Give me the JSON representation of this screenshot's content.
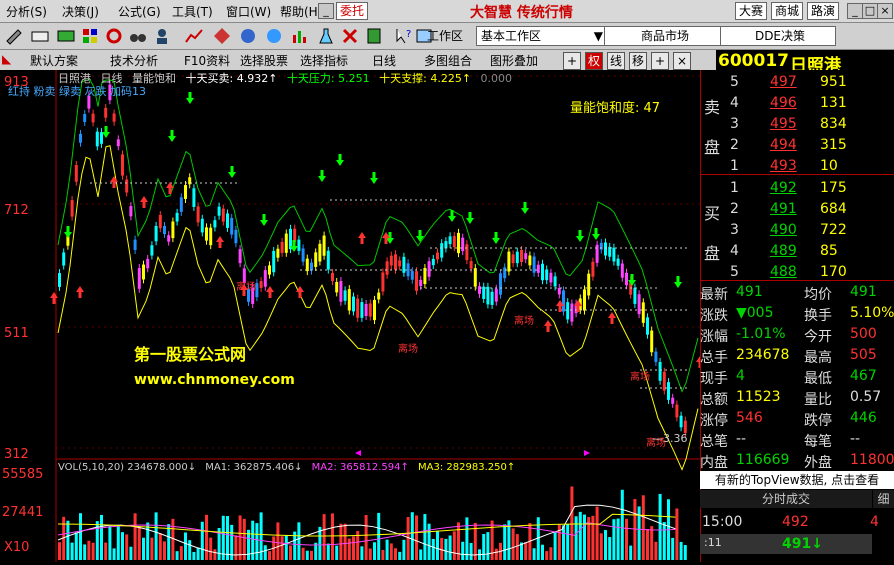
{
  "menu": {
    "items": [
      "分析(S)",
      "决策(J)",
      "公式(G)",
      "工具(T)",
      "窗口(W)",
      "帮助(H)"
    ],
    "trade": "委托",
    "brand": "大智慧 传统行情",
    "right_buttons": [
      "大赛",
      "商城",
      "路演"
    ]
  },
  "toolbar": {
    "workspace_label": "工作区",
    "workspace_value": "基本工作区",
    "market": "商品市场",
    "dde": "DDE决策"
  },
  "funcbar": {
    "items": [
      "默认方案",
      "技术分析",
      "F10资料",
      "选择股票",
      "选择指标",
      "日线",
      "多图组合",
      "图形叠加"
    ],
    "squares": [
      "权",
      "线",
      "移",
      "+",
      "×"
    ]
  },
  "stock": {
    "code": "600017",
    "name": "日照港"
  },
  "chart": {
    "top_line": {
      "name": "日照港",
      "period": "日线",
      "indicator": "量能饱和",
      "items": [
        {
          "label": "十天买卖: 4.932↑",
          "value": "4.932↑",
          "color": "#ffffff"
        },
        {
          "label": "十天压力: 5.251",
          "value": "5.251",
          "color": "#00ff00"
        },
        {
          "label": "十天支撑: 4.225↑",
          "value": "4.225↑",
          "color": "#ffff00"
        },
        {
          "label": "0.000",
          "value": "0.000",
          "color": "#888888"
        }
      ]
    },
    "legend2": "红持 粉卖 绿卖 灰跌 加码13",
    "saturation": "量能饱和度: 47",
    "watermark_title": "第一股票公式网",
    "watermark_url": "www.chnmoney.com",
    "low_label": "3.36",
    "signal_text": "离场",
    "y_labels": [
      "913",
      "712",
      "511",
      "312"
    ],
    "vol_title": "VOL(5,10,20) 234678.000↓",
    "ma1": "MA1: 362875.406↓",
    "ma2": "MA2: 365812.594↑",
    "ma3": "MA3: 282983.250↑",
    "vol_labels": [
      "55585",
      "27441"
    ],
    "vol_unit": "X10"
  },
  "quote": {
    "sell_label": [
      "卖",
      "盘"
    ],
    "buy_label": [
      "买",
      "盘"
    ],
    "asks": [
      {
        "lvl": "5",
        "price": "497",
        "vol": "951"
      },
      {
        "lvl": "4",
        "price": "496",
        "vol": "131"
      },
      {
        "lvl": "3",
        "price": "495",
        "vol": "834"
      },
      {
        "lvl": "2",
        "price": "494",
        "vol": "315"
      },
      {
        "lvl": "1",
        "price": "493",
        "vol": "10"
      }
    ],
    "bids": [
      {
        "lvl": "1",
        "price": "492",
        "vol": "175"
      },
      {
        "lvl": "2",
        "price": "491",
        "vol": "684"
      },
      {
        "lvl": "3",
        "price": "490",
        "vol": "722"
      },
      {
        "lvl": "4",
        "price": "489",
        "vol": "85"
      },
      {
        "lvl": "5",
        "price": "488",
        "vol": "170"
      }
    ],
    "stats": [
      {
        "k1": "最新",
        "v1": "491",
        "c1": "g",
        "k2": "均价",
        "v2": "491",
        "c2": "g"
      },
      {
        "k1": "涨跌",
        "v1": "▼005",
        "c1": "g",
        "k2": "换手",
        "v2": "5.10%",
        "c2": "y"
      },
      {
        "k1": "涨幅",
        "v1": "-1.01%",
        "c1": "g",
        "k2": "今开",
        "v2": "500",
        "c2": "r"
      },
      {
        "k1": "总手",
        "v1": "234678",
        "c1": "y",
        "k2": "最高",
        "v2": "505",
        "c2": "r"
      },
      {
        "k1": "现手",
        "v1": "4",
        "c1": "g",
        "k2": "最低",
        "v2": "467",
        "c2": "g"
      },
      {
        "k1": "总额",
        "v1": "11523",
        "c1": "y",
        "k2": "量比",
        "v2": "0.57",
        "c2": "w"
      },
      {
        "k1": "涨停",
        "v1": "546",
        "c1": "r",
        "k2": "跌停",
        "v2": "446",
        "c2": "g"
      },
      {
        "k1": "总笔",
        "v1": "--",
        "c1": "w",
        "k2": "每笔",
        "v2": "--",
        "c2": "w"
      },
      {
        "k1": "内盘",
        "v1": "116669",
        "c1": "g",
        "k2": "外盘",
        "v2": "118009",
        "c2": "r"
      }
    ],
    "topview": "有新的TopView数据, 点击查看",
    "tick_header": "分时成交",
    "tick_side": "细",
    "ticks": [
      {
        "time": "15:00",
        "price": "492",
        "vol": "4"
      },
      {
        "time": ":11",
        "price": "491↓",
        "vol": ""
      }
    ]
  },
  "colors": {
    "up": "#ff3232",
    "down": "#00ffff",
    "ma_green": "#00c800",
    "support": "#ffff00"
  }
}
